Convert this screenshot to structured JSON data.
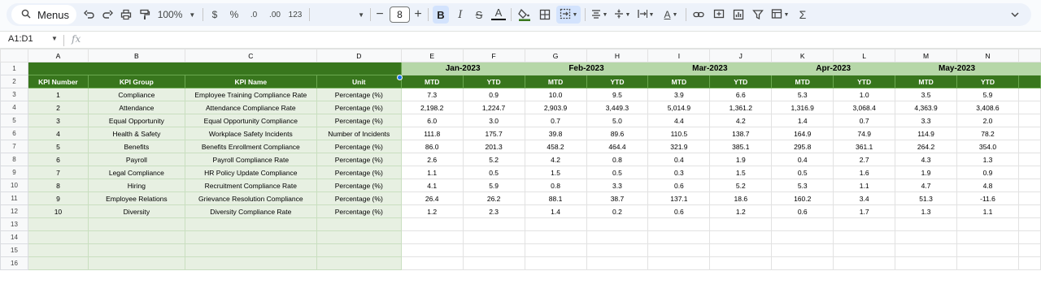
{
  "toolbar": {
    "menus_label": "Menus",
    "zoom": "100%",
    "currency": "$",
    "percent": "%",
    "dec_decrease": ".0",
    "dec_increase": ".00",
    "number_format": "123",
    "font_size": "8",
    "bold": "B",
    "italic": "I",
    "strikethrough": "S",
    "text_color": "A",
    "sigma": "Σ"
  },
  "formula_bar": {
    "name_box": "A1:D1",
    "fx": "fx",
    "formula": ""
  },
  "columns": [
    "A",
    "B",
    "C",
    "D",
    "E",
    "F",
    "G",
    "H",
    "I",
    "J",
    "K",
    "L",
    "M",
    "N"
  ],
  "months": [
    "Jan-2023",
    "Feb-2023",
    "Mar-2023",
    "Apr-2023",
    "May-2023"
  ],
  "subheaders": [
    "MTD",
    "YTD"
  ],
  "headers": {
    "kpi_number": "KPI Number",
    "kpi_group": "KPI Group",
    "kpi_name": "KPI Name",
    "unit": "Unit"
  },
  "rows": [
    {
      "n": "1",
      "group": "Compliance",
      "name": "Employee Training Compliance Rate",
      "unit": "Percentage (%)",
      "v": [
        "7.3",
        "0.9",
        "10.0",
        "9.5",
        "3.9",
        "6.6",
        "5.3",
        "1.0",
        "3.5",
        "5.9"
      ]
    },
    {
      "n": "2",
      "group": "Attendance",
      "name": "Attendance Compliance Rate",
      "unit": "Percentage (%)",
      "v": [
        "2,198.2",
        "1,224.7",
        "2,903.9",
        "3,449.3",
        "5,014.9",
        "1,361.2",
        "1,316.9",
        "3,068.4",
        "4,363.9",
        "3,408.6"
      ]
    },
    {
      "n": "3",
      "group": "Equal Opportunity",
      "name": "Equal Opportunity Compliance",
      "unit": "Percentage (%)",
      "v": [
        "6.0",
        "3.0",
        "0.7",
        "5.0",
        "4.4",
        "4.2",
        "1.4",
        "0.7",
        "3.3",
        "2.0"
      ]
    },
    {
      "n": "4",
      "group": "Health & Safety",
      "name": "Workplace Safety Incidents",
      "unit": "Number of Incidents",
      "v": [
        "111.8",
        "175.7",
        "39.8",
        "89.6",
        "110.5",
        "138.7",
        "164.9",
        "74.9",
        "114.9",
        "78.2"
      ]
    },
    {
      "n": "5",
      "group": "Benefits",
      "name": "Benefits Enrollment Compliance",
      "unit": "Percentage (%)",
      "v": [
        "86.0",
        "201.3",
        "458.2",
        "464.4",
        "321.9",
        "385.1",
        "295.8",
        "361.1",
        "264.2",
        "354.0"
      ]
    },
    {
      "n": "6",
      "group": "Payroll",
      "name": "Payroll Compliance Rate",
      "unit": "Percentage (%)",
      "v": [
        "2.6",
        "5.2",
        "4.2",
        "0.8",
        "0.4",
        "1.9",
        "0.4",
        "2.7",
        "4.3",
        "1.3"
      ]
    },
    {
      "n": "7",
      "group": "Legal Compliance",
      "name": "HR Policy Update Compliance",
      "unit": "Percentage (%)",
      "v": [
        "1.1",
        "0.5",
        "1.5",
        "0.5",
        "0.3",
        "1.5",
        "0.5",
        "1.6",
        "1.9",
        "0.9"
      ]
    },
    {
      "n": "8",
      "group": "Hiring",
      "name": "Recruitment Compliance Rate",
      "unit": "Percentage (%)",
      "v": [
        "4.1",
        "5.9",
        "0.8",
        "3.3",
        "0.6",
        "5.2",
        "5.3",
        "1.1",
        "4.7",
        "4.8"
      ]
    },
    {
      "n": "9",
      "group": "Employee Relations",
      "name": "Grievance Resolution Compliance",
      "unit": "Percentage (%)",
      "v": [
        "26.4",
        "26.2",
        "88.1",
        "38.7",
        "137.1",
        "18.6",
        "160.2",
        "3.4",
        "51.3",
        "-11.6"
      ]
    },
    {
      "n": "10",
      "group": "Diversity",
      "name": "Diversity Compliance Rate",
      "unit": "Percentage (%)",
      "v": [
        "1.2",
        "2.3",
        "1.4",
        "0.2",
        "0.6",
        "1.2",
        "0.6",
        "1.7",
        "1.3",
        "1.1"
      ]
    }
  ],
  "row_numbers": [
    "1",
    "2",
    "3",
    "4",
    "5",
    "6",
    "7",
    "8",
    "9",
    "10",
    "11",
    "12",
    "13",
    "14",
    "15",
    "16"
  ]
}
